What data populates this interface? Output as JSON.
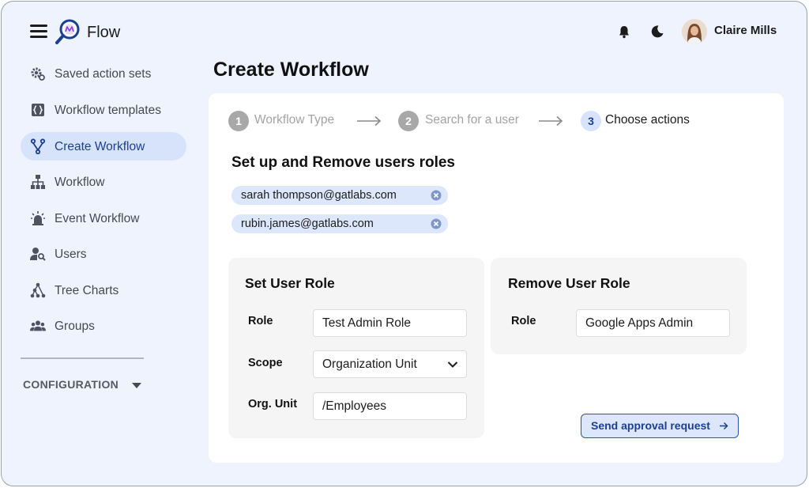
{
  "app": {
    "name": "Flow"
  },
  "header": {
    "user_name": "Claire Mills"
  },
  "sidebar": {
    "items": [
      {
        "label": "Saved action sets",
        "icon": "gear-cog-icon"
      },
      {
        "label": "Workflow templates",
        "icon": "braces-icon"
      },
      {
        "label": "Create Workflow",
        "icon": "branch-icon",
        "active": true
      },
      {
        "label": "Workflow",
        "icon": "hierarchy-icon"
      },
      {
        "label": "Event Workflow",
        "icon": "alarm-icon"
      },
      {
        "label": "Users",
        "icon": "user-search-icon"
      },
      {
        "label": "Tree Charts",
        "icon": "tree-chart-icon"
      },
      {
        "label": "Groups",
        "icon": "groups-icon"
      }
    ],
    "config_label": "CONFIGURATION"
  },
  "main": {
    "title": "Create Workflow",
    "steps": [
      {
        "number": "1",
        "label": "Workflow Type"
      },
      {
        "number": "2",
        "label": "Search for a user"
      },
      {
        "number": "3",
        "label": "Choose actions"
      }
    ],
    "section_title": "Set up and Remove users roles",
    "chips": [
      "sarah thompson@gatlabs.com",
      "rubin.james@gatlabs.com"
    ],
    "set_role": {
      "title": "Set User Role",
      "role_label": "Role",
      "role_value": "Test Admin Role",
      "scope_label": "Scope",
      "scope_value": "Organization Unit",
      "org_label": "Org. Unit",
      "org_value": "/Employees"
    },
    "remove_role": {
      "title": "Remove User Role",
      "role_label": "Role",
      "role_value": "Google Apps Admin"
    },
    "send_button": "Send approval request"
  },
  "colors": {
    "app_background": "#eef3fe",
    "accent": "#1d3f91",
    "active_nav": "#d7e3fb",
    "chip": "#dde7fb"
  }
}
